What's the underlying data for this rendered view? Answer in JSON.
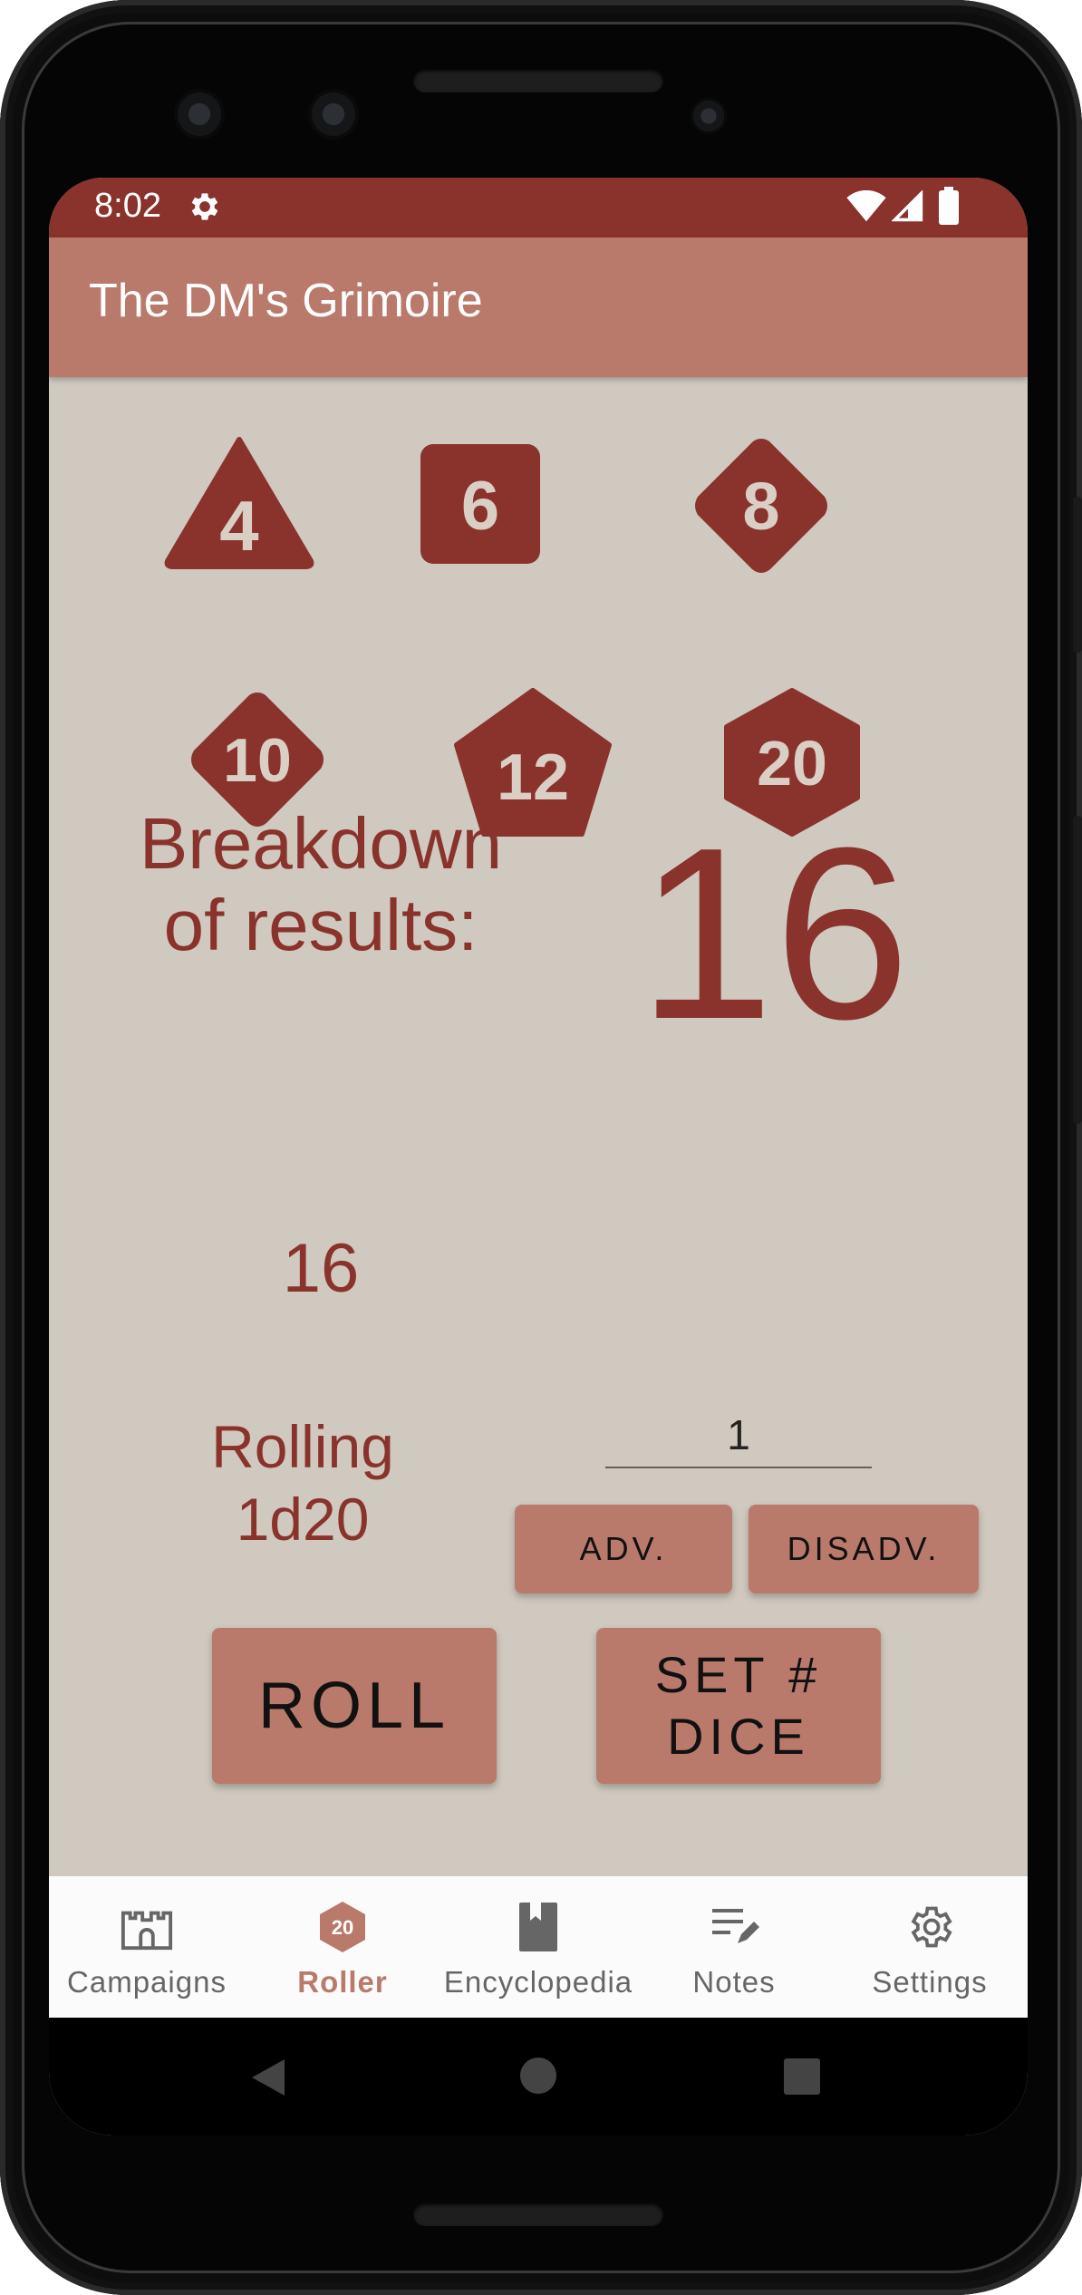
{
  "status_bar": {
    "time": "8:02",
    "icons": [
      "gear-icon",
      "wifi-icon",
      "signal-icon",
      "battery-icon"
    ]
  },
  "app_bar": {
    "title": "The DM's Grimoire"
  },
  "dice": [
    {
      "label": "4",
      "shape": "triangle"
    },
    {
      "label": "6",
      "shape": "square"
    },
    {
      "label": "8",
      "shape": "diamond"
    },
    {
      "label": "10",
      "shape": "diamond"
    },
    {
      "label": "12",
      "shape": "pentagon"
    },
    {
      "label": "20",
      "shape": "hexagon"
    }
  ],
  "result": {
    "breakdown_label": "Breakdown of results:",
    "total": "16",
    "breakdown_values": "16"
  },
  "roll_setup": {
    "rolling_label": "Rolling",
    "rolling_value": "1d20",
    "dice_count": "1",
    "adv_label": "ADV.",
    "disadv_label": "DISADV.",
    "roll_label": "ROLL",
    "set_dice_label": "SET # DICE"
  },
  "bottom_nav": {
    "items": [
      {
        "label": "Campaigns",
        "icon": "castle-icon",
        "active": false
      },
      {
        "label": "Roller",
        "icon": "d20-icon",
        "active": true
      },
      {
        "label": "Encyclopedia",
        "icon": "book-icon",
        "active": false
      },
      {
        "label": "Notes",
        "icon": "notes-icon",
        "active": false
      },
      {
        "label": "Settings",
        "icon": "gear-icon",
        "active": false
      }
    ]
  },
  "colors": {
    "primary_dark": "#8a322c",
    "primary": "#b97a6b",
    "background": "#d0c9bf",
    "die_text": "#d9cfc4"
  }
}
